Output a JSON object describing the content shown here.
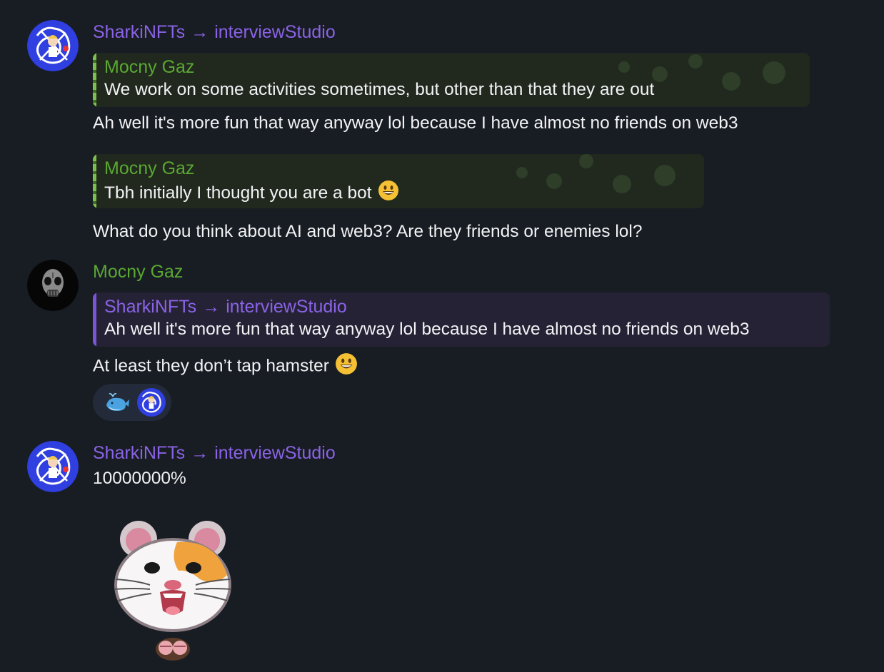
{
  "messages": [
    {
      "sender": {
        "from": "SharkiNFTs",
        "to": "interviewStudio"
      },
      "quote": {
        "name": "Mocny Gaz",
        "text": "We work on some activities sometimes, but other than that they are out"
      },
      "text": "Ah well it's more fun that way anyway lol because I have almost no friends on web3"
    },
    {
      "quote": {
        "name": "Mocny Gaz",
        "text": "Tbh initially I thought you are a bot"
      },
      "text": "What do you think about AI and web3? Are they friends or enemies lol?"
    },
    {
      "sender": {
        "name": "Mocny Gaz"
      },
      "quote": {
        "from": "SharkiNFTs",
        "to": "interviewStudio",
        "text": "Ah well it's more fun that way anyway lol because I have almost no friends on web3"
      },
      "text": "At least they don’t tap hamster",
      "reactions": [
        "whale-emoji",
        "sharkinfts-avatar"
      ]
    },
    {
      "sender": {
        "from": "SharkiNFTs",
        "to": "interviewStudio"
      },
      "text": "10000000%",
      "sticker": "hamster-sticker"
    }
  ],
  "arrow": "→",
  "colors": {
    "background": "#181c23",
    "purple_name": "#8a63e6",
    "green_name": "#5aa832"
  }
}
